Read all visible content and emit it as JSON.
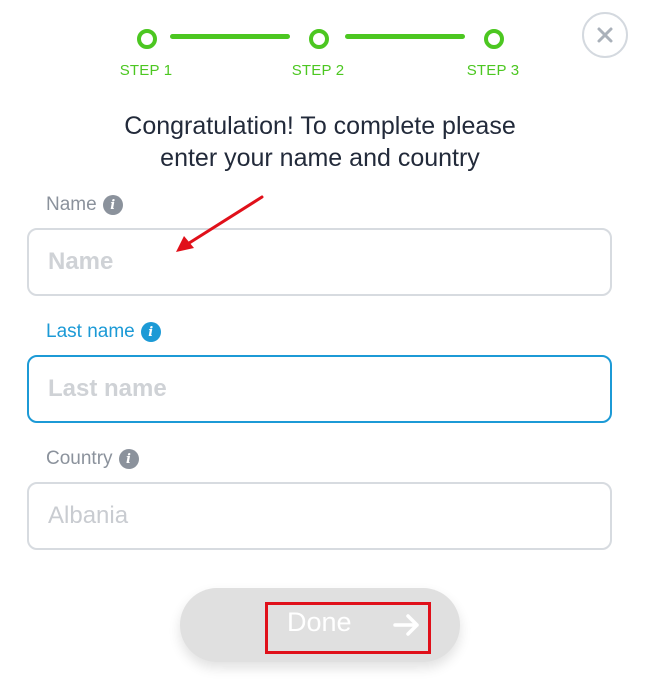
{
  "stepper": {
    "steps": [
      {
        "label": "STEP 1"
      },
      {
        "label": "STEP 2"
      },
      {
        "label": "STEP 3"
      }
    ],
    "color": "#4cc721"
  },
  "close_button": {
    "icon": "close-icon"
  },
  "heading": {
    "line1": "Congratulation! To complete please",
    "line2": "enter your name and country"
  },
  "form": {
    "name": {
      "label": "Name",
      "placeholder": "Name",
      "value": "",
      "info_icon": "info-icon"
    },
    "last_name": {
      "label": "Last name",
      "placeholder": "Last name",
      "value": "",
      "info_icon": "info-icon",
      "focused": true
    },
    "country": {
      "label": "Country",
      "placeholder": "Albania",
      "value": "",
      "info_icon": "info-icon"
    }
  },
  "done_button": {
    "label": "Done",
    "icon": "arrow-right-icon"
  },
  "colors": {
    "accent_green": "#4cc721",
    "accent_blue": "#1c9ad6",
    "annotation_red": "#e0101a",
    "heading_text": "#222a3a"
  }
}
